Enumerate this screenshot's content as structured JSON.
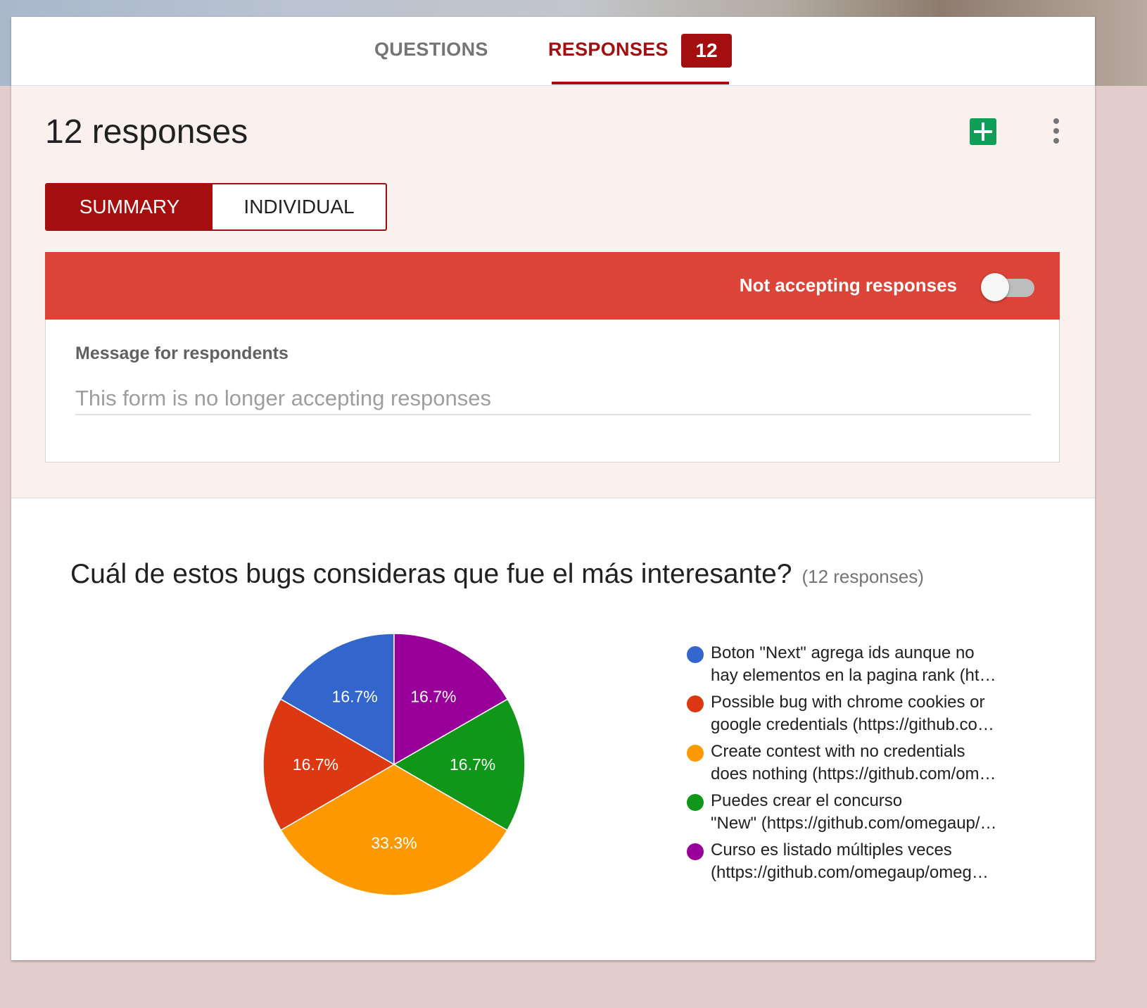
{
  "tabs": {
    "questions_label": "QUESTIONS",
    "responses_label": "RESPONSES",
    "responses_count": "12",
    "active": "responses"
  },
  "header": {
    "title": "12 responses",
    "sheets_icon": "sheets-plus-icon",
    "more_icon": "more-vert-icon"
  },
  "view_toggle": {
    "summary_label": "SUMMARY",
    "individual_label": "INDIVIDUAL",
    "selected": "summary"
  },
  "accepting": {
    "label": "Not accepting responses",
    "enabled": false
  },
  "message": {
    "label": "Message for respondents",
    "value": "",
    "placeholder": "This form is no longer accepting responses"
  },
  "question": {
    "title": "Cuál de estos bugs consideras que fue el más interesante?",
    "count": "(12 responses)"
  },
  "colors": {
    "accent": "#a50e0e",
    "banner": "#db4437",
    "sheets_green": "#0f9d58"
  },
  "chart_data": {
    "type": "pie",
    "slices": [
      {
        "lines": [
          "Boton \"Next\" agrega ids aunque no",
          "hay elementos en la pagina rank (ht…"
        ],
        "percent": 16.7,
        "label": "16.7%",
        "color": "#3366cc"
      },
      {
        "lines": [
          "Possible bug with chrome cookies or",
          "google credentials (https://github.co…"
        ],
        "percent": 16.7,
        "label": "16.7%",
        "color": "#dc3912"
      },
      {
        "lines": [
          "Create contest with no credentials",
          "does nothing (https://github.com/om…"
        ],
        "percent": 33.3,
        "label": "33.3%",
        "color": "#ff9900"
      },
      {
        "lines": [
          "Puedes crear el concurso",
          "\"New\" (https://github.com/omegaup/…"
        ],
        "percent": 16.7,
        "label": "16.7%",
        "color": "#109618"
      },
      {
        "lines": [
          "Curso es listado múltiples veces",
          "(https://github.com/omegaup/omeg…"
        ],
        "percent": 16.7,
        "label": "16.7%",
        "color": "#990099"
      }
    ],
    "legend_position": "right"
  }
}
